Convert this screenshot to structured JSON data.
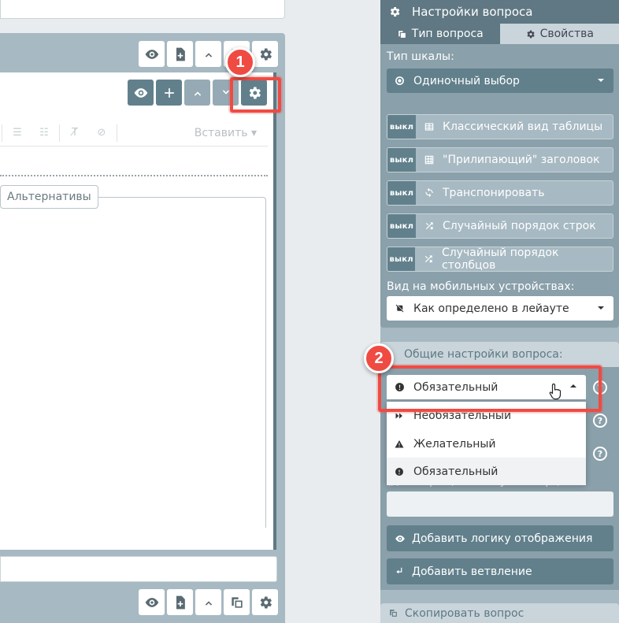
{
  "settings": {
    "title": "Настройки вопроса",
    "tabs": {
      "type": "Тип вопроса",
      "properties": "Свойства"
    },
    "scale_type_label": "Тип шкалы:",
    "scale_type_value": "Одиночный выбор",
    "toggle_off_label": "выкл",
    "toggles": [
      {
        "label": "Классический вид таблицы",
        "icon": "table-icon"
      },
      {
        "label": "\"Прилипающий\" заголовок",
        "icon": "grid-icon"
      },
      {
        "label": "Транспонировать",
        "icon": "transpose-icon"
      },
      {
        "label": "Случайный порядок строк",
        "icon": "shuffle-icon"
      },
      {
        "label": "Случайный порядок столбцов",
        "icon": "shuffle-icon"
      }
    ],
    "mobile_view_label": "Вид на мобильных устройствах:",
    "mobile_view_value": "Как определено в лейауте",
    "general_header": "Общие настройки вопроса:",
    "required_value": "Обязательный",
    "required_options": [
      "Необязательный",
      "Желательный",
      "Обязательный"
    ],
    "hidden_label": "(для обращения из JavaScript):",
    "add_logic_label": "Добавить логику отображения",
    "add_branch_label": "Добавить ветвление",
    "copy_question_label": "Скопировать вопрос"
  },
  "editor": {
    "alternatives_tab": "Альтернативы",
    "insert_label": "Вставить"
  },
  "annotations": {
    "badge1": "1",
    "badge2": "2",
    "accent": "#ef4b43"
  }
}
